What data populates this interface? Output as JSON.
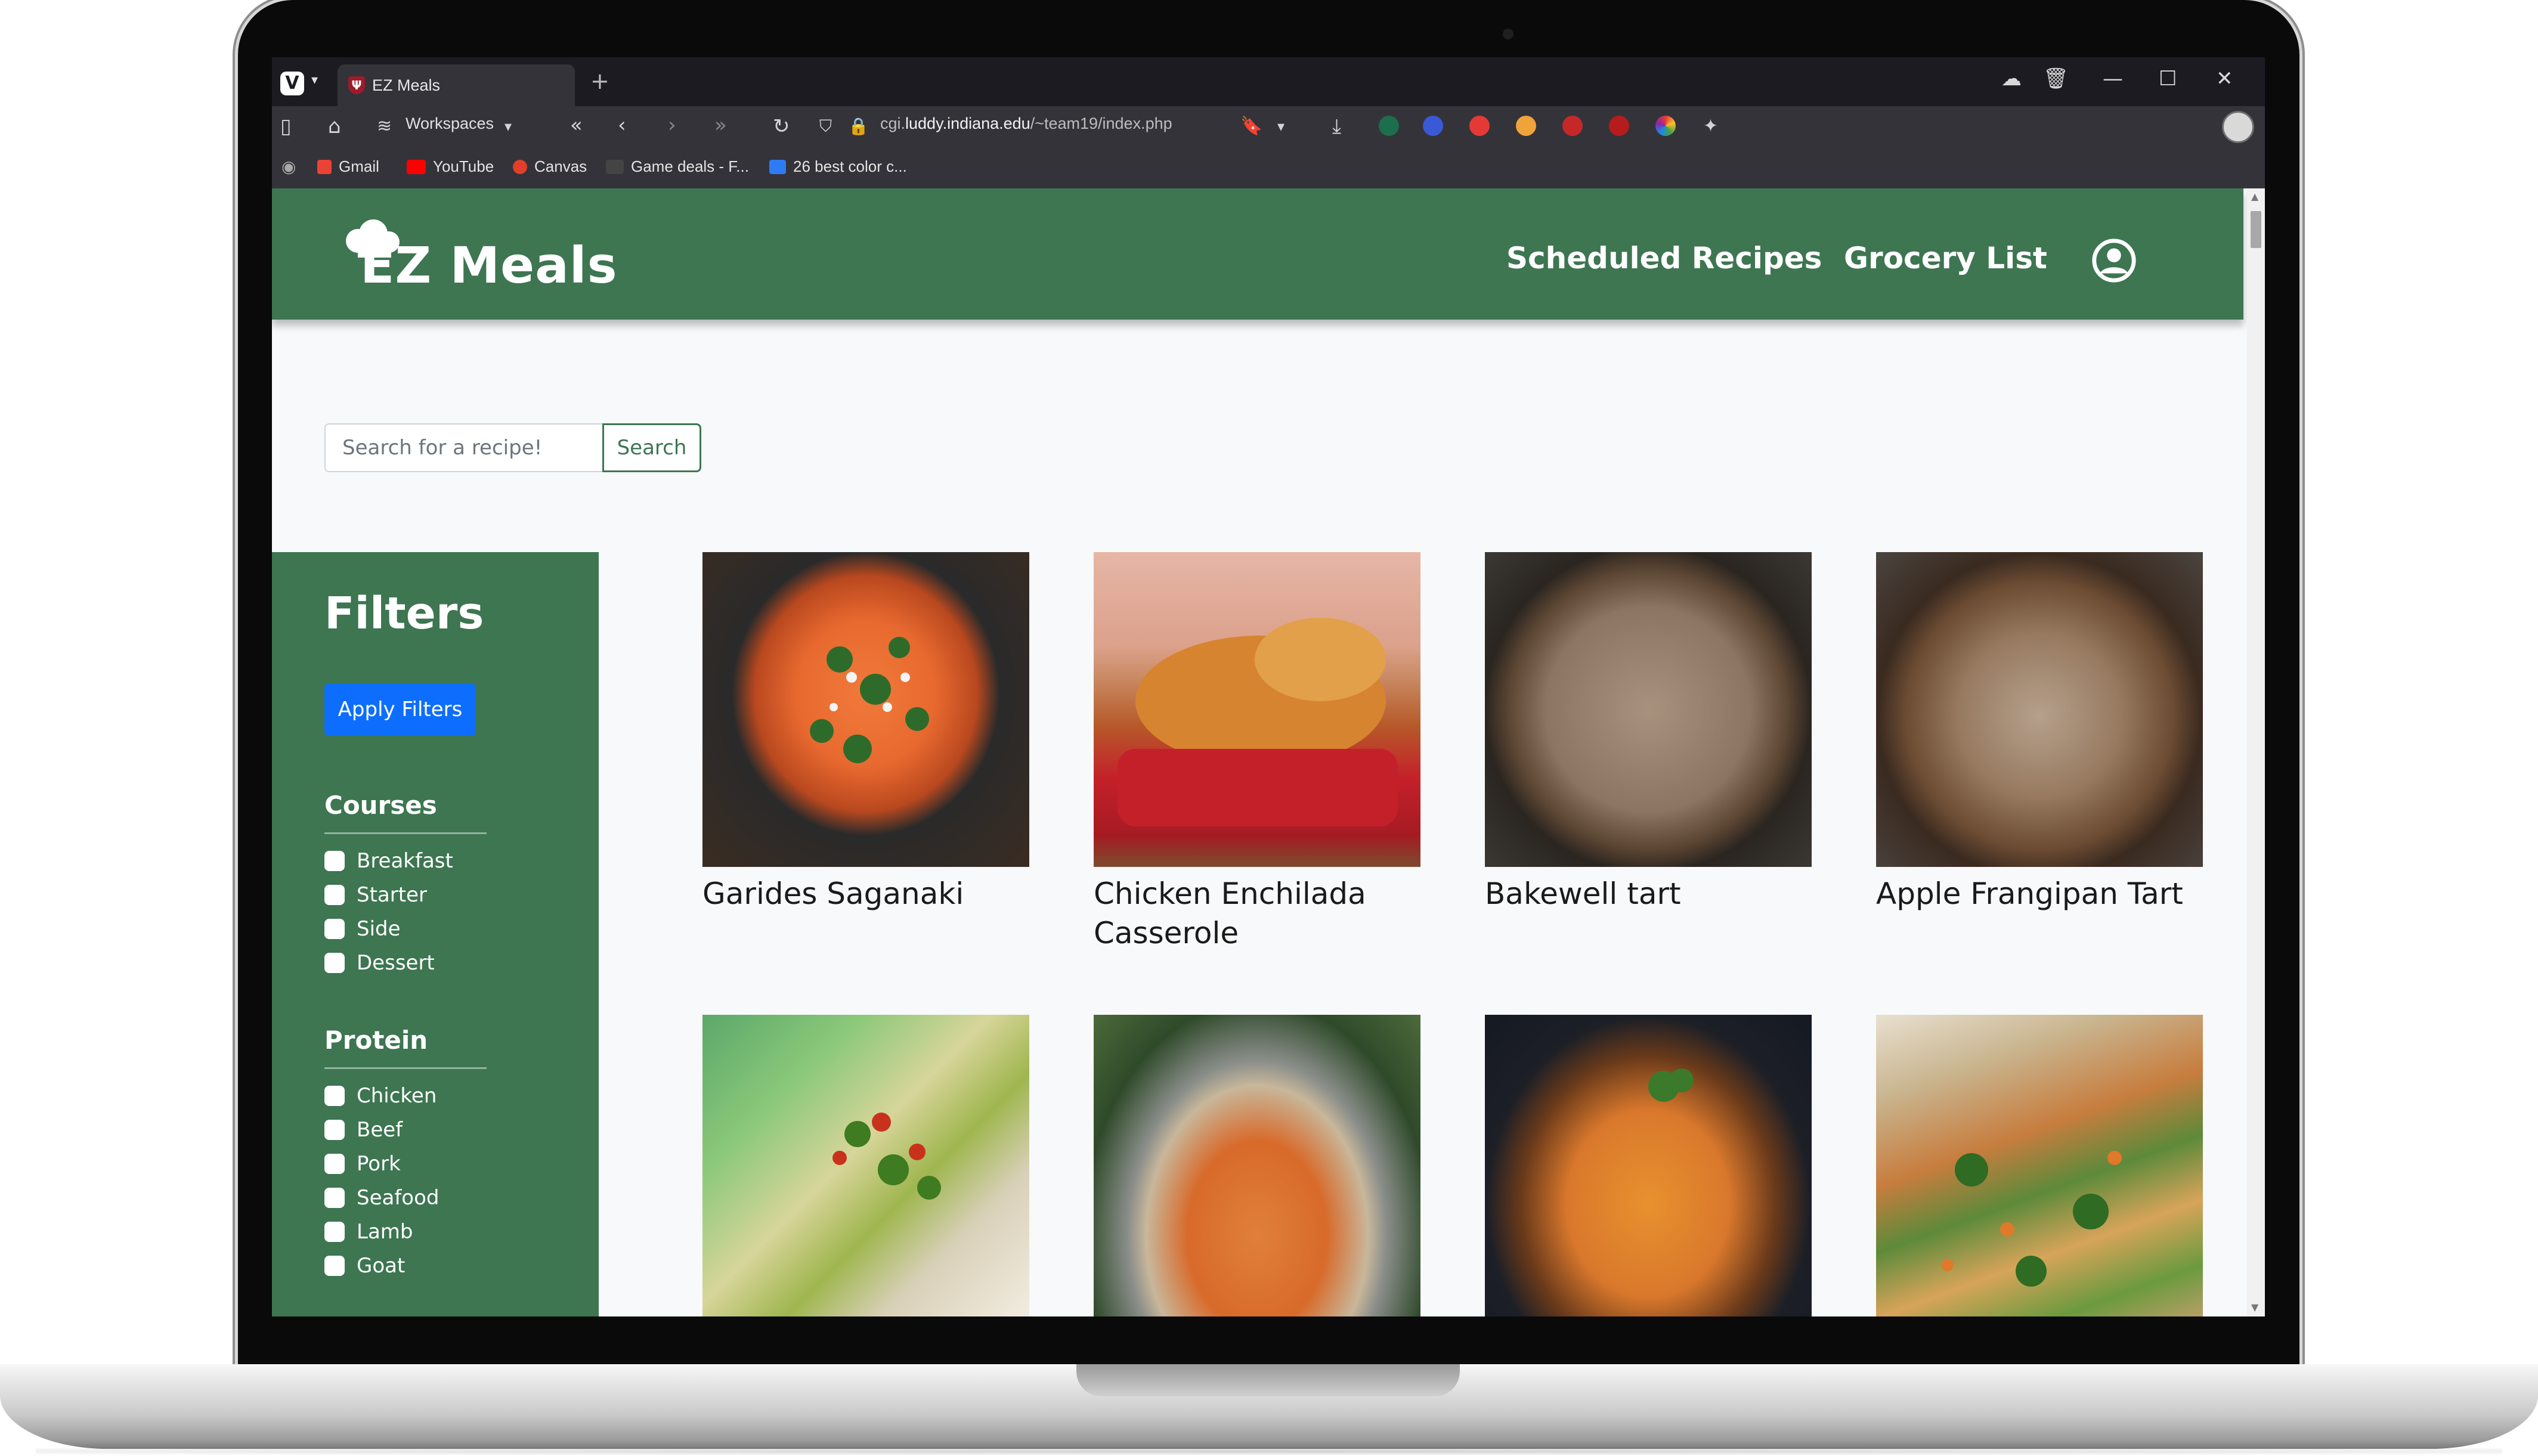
{
  "browser": {
    "tab_title": "EZ Meals",
    "new_tab_label": "+",
    "workspaces_label": "Workspaces",
    "url_prefix": "cgi.",
    "url_host": "luddy.indiana.edu",
    "url_path": "/~team19/index.php",
    "bookmarks": [
      {
        "label": "Gmail",
        "color": "#ea4335"
      },
      {
        "label": "YouTube",
        "color": "#ff0000"
      },
      {
        "label": "Canvas",
        "color": "#e13f2b"
      },
      {
        "label": "Game deals - F...",
        "color": "#222222"
      },
      {
        "label": "26 best color c...",
        "color": "#2f7bf5"
      }
    ]
  },
  "site": {
    "brand": "EZ Meals",
    "nav": {
      "scheduled": "Scheduled Recipes",
      "grocery": "Grocery List"
    },
    "accent": "#3d7651",
    "search": {
      "placeholder": "Search for a recipe!",
      "button": "Search"
    },
    "filters": {
      "title": "Filters",
      "apply": "Apply Filters",
      "groups": [
        {
          "title": "Courses",
          "options": [
            "Breakfast",
            "Starter",
            "Side",
            "Dessert"
          ]
        },
        {
          "title": "Protein",
          "options": [
            "Chicken",
            "Beef",
            "Pork",
            "Seafood",
            "Lamb",
            "Goat"
          ]
        }
      ]
    },
    "recipes": [
      {
        "name": "Garides Saganaki"
      },
      {
        "name": "Chicken Enchilada Casserole"
      },
      {
        "name": "Bakewell tart"
      },
      {
        "name": "Apple Frangipan Tart"
      },
      {
        "name": ""
      },
      {
        "name": ""
      },
      {
        "name": ""
      },
      {
        "name": ""
      }
    ]
  }
}
